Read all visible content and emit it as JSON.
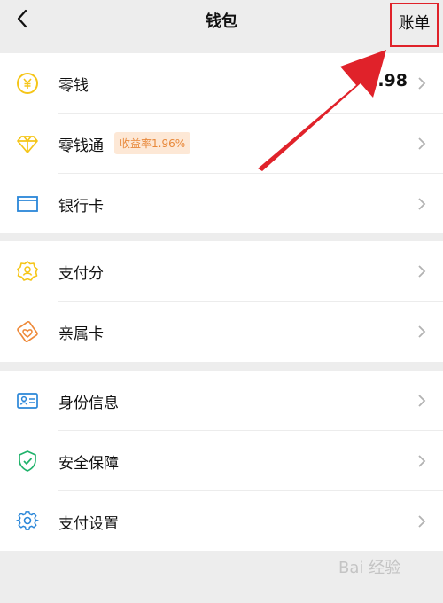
{
  "header": {
    "title": "钱包",
    "bill_label": "账单"
  },
  "groups": [
    {
      "items": [
        {
          "label": "零钱",
          "value": "2.98"
        },
        {
          "label": "零钱通",
          "badge": "收益率1.96%"
        },
        {
          "label": "银行卡"
        }
      ]
    },
    {
      "items": [
        {
          "label": "支付分"
        },
        {
          "label": "亲属卡"
        }
      ]
    },
    {
      "items": [
        {
          "label": "身份信息"
        },
        {
          "label": "安全保障"
        },
        {
          "label": "支付设置"
        }
      ]
    }
  ],
  "watermark": {
    "text": "Bai 经验"
  },
  "colors": {
    "annotation_red": "#e0222a",
    "yellow_icon": "#f5c518",
    "blue_icon": "#2a86d8",
    "orange_icon": "#ee8a3a",
    "green_icon": "#20b26b"
  }
}
